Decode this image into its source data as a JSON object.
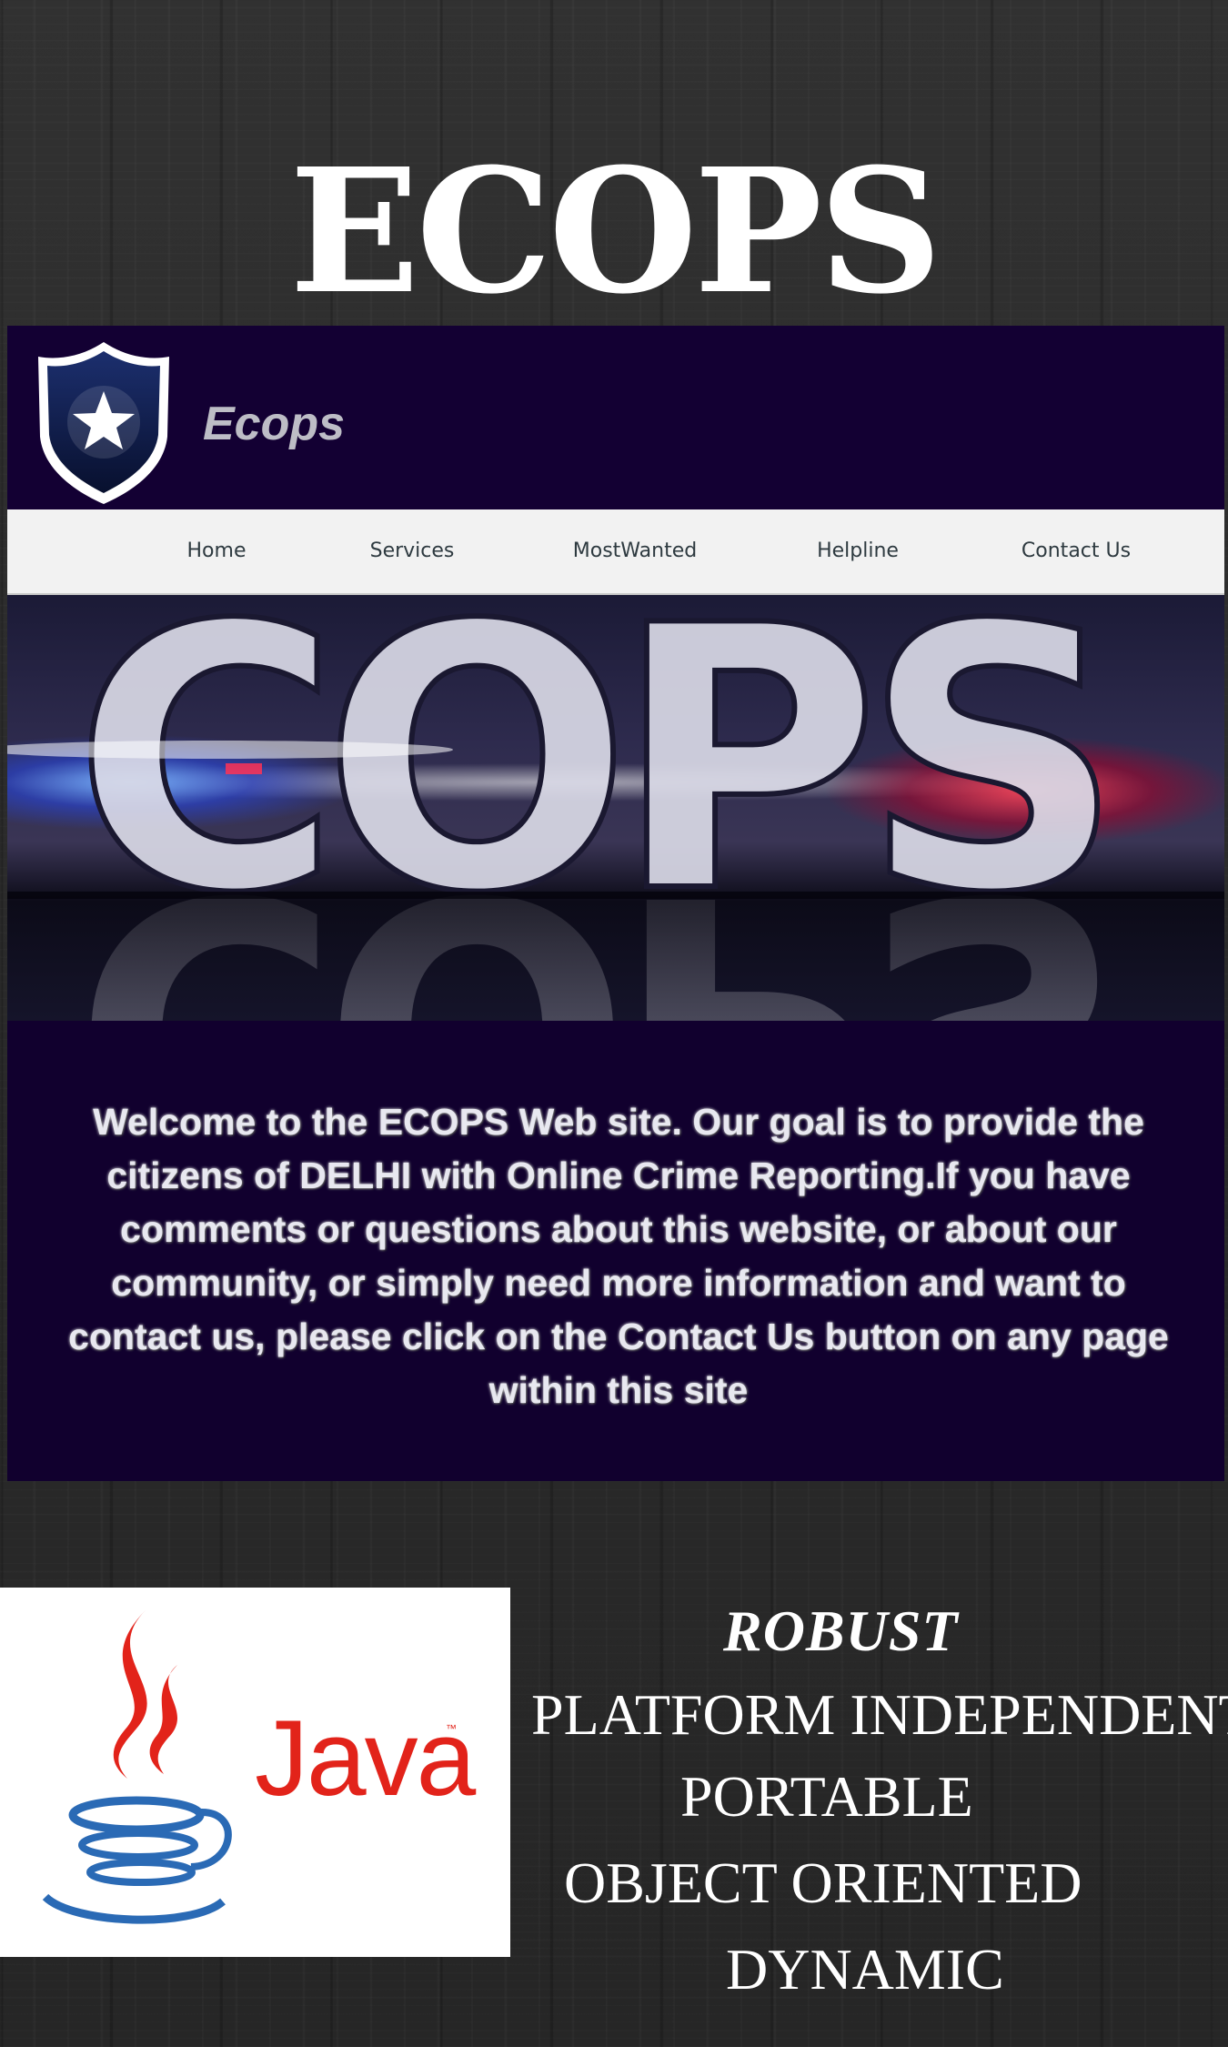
{
  "poster": {
    "title": "ECOPS"
  },
  "site": {
    "name": "Ecops",
    "logo_icon": "police-badge-star-icon",
    "colors": {
      "header_bg": "#130033",
      "nav_bg": "#f2f2f2",
      "content_bg": "#11002e"
    }
  },
  "nav": {
    "items": [
      {
        "label": "Home"
      },
      {
        "label": "Services"
      },
      {
        "label": "MostWanted"
      },
      {
        "label": "Helpline"
      },
      {
        "label": "Contact Us"
      }
    ]
  },
  "banner": {
    "text": "COPS"
  },
  "welcome": {
    "text": "Welcome to the ECOPS Web site. Our goal is to provide the citizens of DELHI with Online Crime Reporting.If you have comments or questions about this website, or about our community, or simply need more information and want to contact us, please click on the Contact Us button on any page within this site"
  },
  "java": {
    "label": "Java",
    "trademark": "™",
    "icon": "java-coffee-cup-icon",
    "colors": {
      "red": "#e2231a",
      "blue": "#2a6ab5"
    }
  },
  "features": [
    {
      "label": "ROBUST"
    },
    {
      "label": "PLATFORM INDEPENDENT"
    },
    {
      "label": "PORTABLE"
    },
    {
      "label": "OBJECT ORIENTED"
    },
    {
      "label": "DYNAMIC"
    }
  ]
}
